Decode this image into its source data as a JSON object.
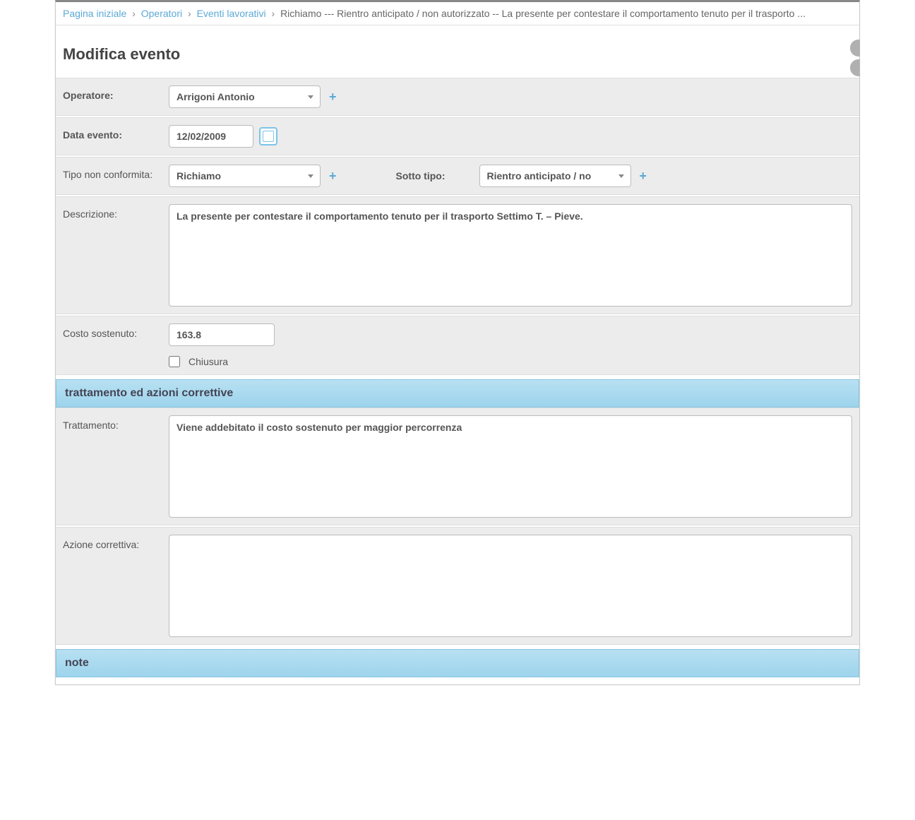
{
  "breadcrumb": {
    "home": "Pagina iniziale",
    "op": "Operatori",
    "events": "Eventi lavorativi",
    "current": "Richiamo --- Rientro anticipato / non autorizzato -- La presente per contestare il comportamento tenuto per il trasporto ..."
  },
  "page_title": "Modifica evento",
  "labels": {
    "operatore": "Operatore:",
    "data_evento": "Data evento:",
    "tipo_nc": "Tipo non conformita:",
    "sotto_tipo": "Sotto tipo:",
    "descrizione": "Descrizione:",
    "costo": "Costo sostenuto:",
    "chiusura": "Chiusura",
    "trattamento": "Trattamento:",
    "azione": "Azione correttiva:"
  },
  "values": {
    "operatore": "Arrigoni Antonio",
    "data_evento": "12/02/2009",
    "tipo_nc": "Richiamo",
    "sotto_tipo": "Rientro anticipato / no",
    "descrizione": "La presente per contestare il comportamento tenuto per il trasporto Settimo T. – Pieve.",
    "costo": "163.8",
    "chiusura_checked": false,
    "trattamento": "Viene addebitato il costo sostenuto per maggior percorrenza",
    "azione": ""
  },
  "sections": {
    "treatment": "trattamento ed azioni correttive",
    "note": "note"
  }
}
